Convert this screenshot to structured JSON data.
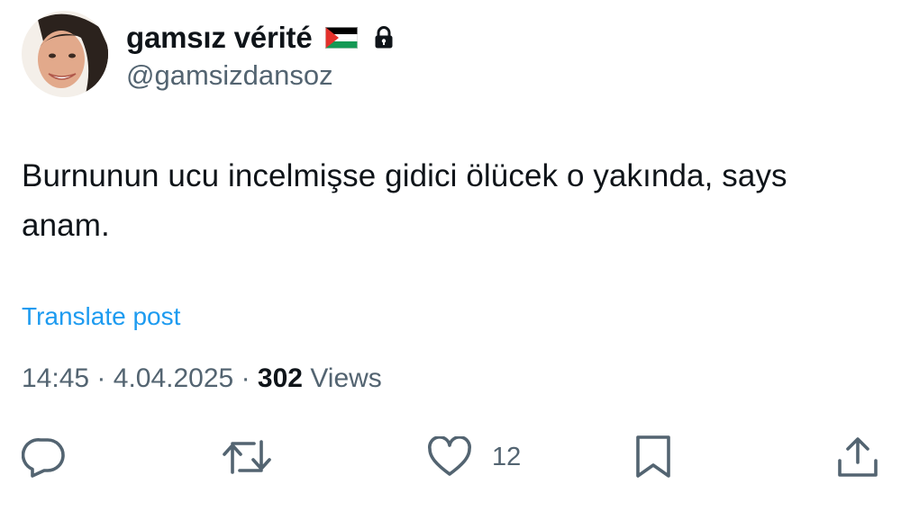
{
  "author": {
    "display_name": "gamsız vérité",
    "handle": "@gamsizdansoz",
    "flag_icon": "palestine-flag-icon",
    "lock_icon": "lock-icon"
  },
  "tweet": {
    "text": "Burnunun ucu incelmişse gidici ölücek o yakında, says anam.",
    "translate_label": "Translate post"
  },
  "meta": {
    "time": "14:45",
    "separator": "·",
    "date": "4.04.2025",
    "views_count": "302",
    "views_label": "Views"
  },
  "actions": {
    "reply_icon": "reply-icon",
    "retweet_icon": "retweet-icon",
    "like_icon": "heart-icon",
    "like_count": "12",
    "bookmark_icon": "bookmark-icon",
    "share_icon": "share-icon"
  },
  "colors": {
    "text": "#0f1419",
    "secondary": "#536471",
    "link": "#1d9bf0"
  }
}
